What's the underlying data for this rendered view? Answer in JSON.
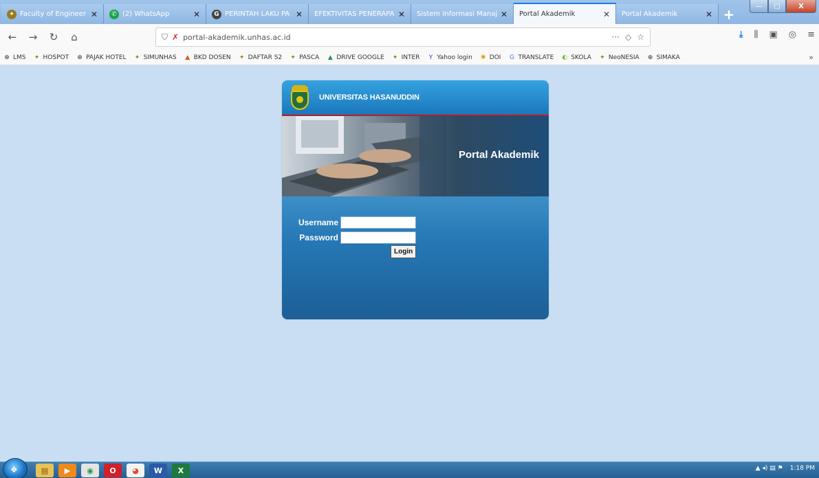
{
  "browser": {
    "tabs": [
      {
        "title": "Faculty of Engineer",
        "fav_color": "#9a7a20",
        "fav_glyph": "✦"
      },
      {
        "title": "(2) WhatsApp",
        "fav_color": "#1aa34a",
        "fav_glyph": "✆"
      },
      {
        "title": "PERINTAH LAKU PA",
        "fav_color": "#444444",
        "fav_glyph": "G"
      },
      {
        "title": "EFEKTIVITAS PENERAPA",
        "fav_color": "",
        "fav_glyph": ""
      },
      {
        "title": "Sistem Informasi Manaj",
        "fav_color": "",
        "fav_glyph": ""
      },
      {
        "title": "Portal Akademik",
        "fav_color": "",
        "fav_glyph": ""
      },
      {
        "title": "Portal Akademik",
        "fav_color": "",
        "fav_glyph": ""
      }
    ],
    "active_tab_index": 5,
    "new_tab_label": "+",
    "window_controls": {
      "minimize": "—",
      "maximize": "▢",
      "close": "X"
    },
    "url": "portal-akademik.unhas.ac.id",
    "url_actions": {
      "more": "···",
      "pocket": "◇",
      "star": "☆"
    },
    "toolbar_right": [
      "⤓",
      "⫼",
      "▣",
      "◎",
      "≡"
    ],
    "bookmarks": [
      {
        "label": "LMS",
        "icon": "⊕",
        "color": "#333333"
      },
      {
        "label": "HOSPOT",
        "icon": "✦",
        "color": "#9a7a20"
      },
      {
        "label": "PAJAK HOTEL",
        "icon": "⊕",
        "color": "#333333"
      },
      {
        "label": "SIMUNHAS",
        "icon": "✦",
        "color": "#9a7a20"
      },
      {
        "label": "BKD DOSEN",
        "icon": "▲",
        "color": "#d9531e"
      },
      {
        "label": "DAFTAR S2",
        "icon": "✦",
        "color": "#9a7a20"
      },
      {
        "label": "PASCA",
        "icon": "✦",
        "color": "#9a7a20"
      },
      {
        "label": "DRIVE GOOGLE",
        "icon": "▲",
        "color": "#1f9a4a"
      },
      {
        "label": "INTER",
        "icon": "✦",
        "color": "#9a7a20"
      },
      {
        "label": "Yahoo login",
        "icon": "Y",
        "color": "#6b1fb8"
      },
      {
        "label": "DOI",
        "icon": "✺",
        "color": "#e0a000"
      },
      {
        "label": "TRANSLATE",
        "icon": "G",
        "color": "#3b7be4"
      },
      {
        "label": "SKOLA",
        "icon": "◐",
        "color": "#6bbf3a"
      },
      {
        "label": "NeoNESIA",
        "icon": "✦",
        "color": "#9a7a20"
      },
      {
        "label": "SIMAKA",
        "icon": "⊕",
        "color": "#333333"
      }
    ],
    "bookmarks_more": "»"
  },
  "portal": {
    "university": "UNIVERSITAS HASANUDDIN",
    "banner_title": "Portal Akademik",
    "username_label": "Username",
    "password_label": "Password",
    "username_value": "",
    "password_value": "",
    "login_label": "Login"
  },
  "taskbar": {
    "start_glyph": "❖",
    "apps": [
      {
        "glyph": "▤",
        "bg": "#e7c255",
        "fg": "#7a4f00"
      },
      {
        "glyph": "▶",
        "bg": "#f08a1a",
        "fg": "#ffffff"
      },
      {
        "glyph": "◉",
        "bg": "#e4e4e4",
        "fg": "#1d9a3c"
      },
      {
        "glyph": "O",
        "bg": "#d21f2a",
        "fg": "#ffffff"
      },
      {
        "glyph": "◕",
        "bg": "#f3f3f3",
        "fg": "#e24a2a"
      },
      {
        "glyph": "W",
        "bg": "#2b5aa8",
        "fg": "#ffffff"
      },
      {
        "glyph": "X",
        "bg": "#1d7a3c",
        "fg": "#ffffff"
      }
    ],
    "tray_icons": "▲  ◂)  ▤  ⚑",
    "clock": "1:18 PM"
  }
}
